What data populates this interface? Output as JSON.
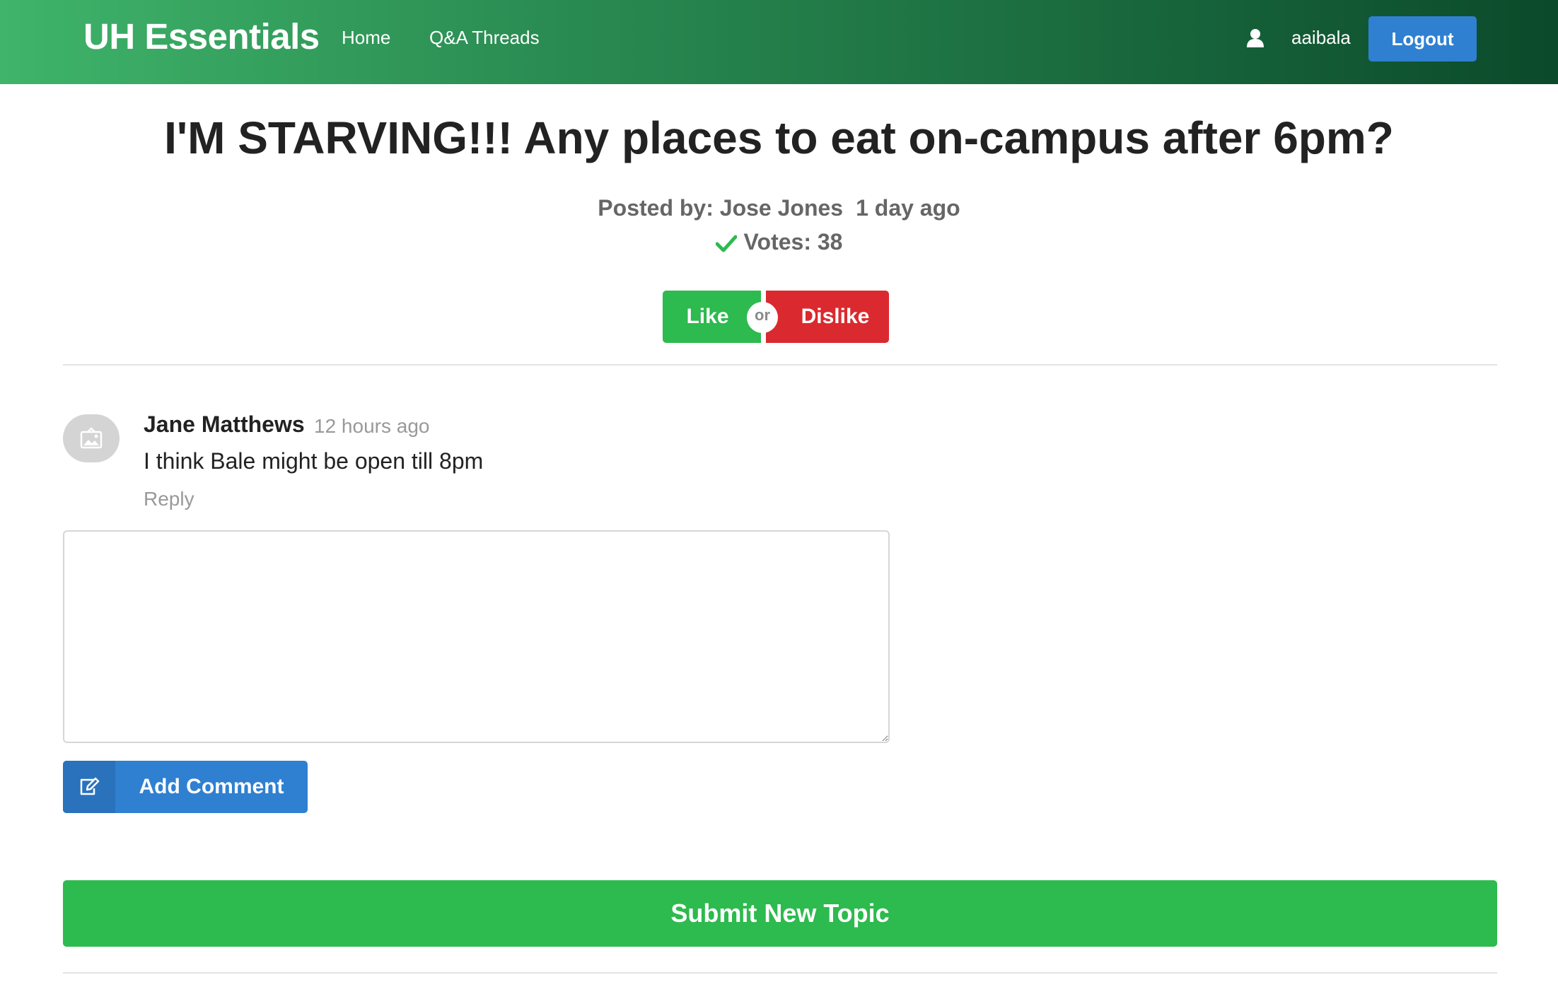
{
  "navbar": {
    "brand": "UH Essentials",
    "links": [
      "Home",
      "Q&A Threads"
    ],
    "username": "aaibala",
    "logout_label": "Logout"
  },
  "topic": {
    "title": "I'M STARVING!!! Any places to eat on-campus after 6pm?",
    "posted_by": "Posted by: Jose Jones",
    "posted_time": "1 day ago",
    "votes_label": "Votes: 38"
  },
  "vote_buttons": {
    "like_label": "Like",
    "or_label": "or",
    "dislike_label": "Dislike"
  },
  "comments": [
    {
      "author": "Jane Matthews",
      "time": "12 hours ago",
      "text": "I think Bale might be open till 8pm",
      "reply_label": "Reply"
    }
  ],
  "comment_form": {
    "value": "",
    "add_label": "Add Comment"
  },
  "submit_topic_label": "Submit New Topic",
  "colors": {
    "like": "#2dba4e",
    "dislike": "#da2a2f",
    "primary": "#2f80d1",
    "nav_start": "#3fb46a",
    "nav_end": "#0b4a2b"
  }
}
